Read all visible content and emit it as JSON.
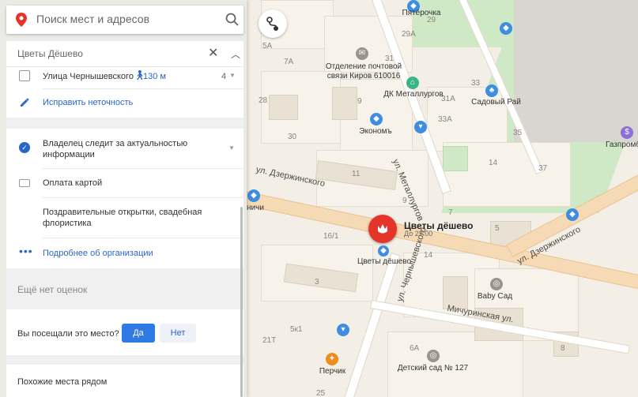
{
  "search": {
    "placeholder": "Поиск мест и адресов"
  },
  "card": {
    "title": "Цветы Дёшево",
    "address": {
      "street": "Улица Чернышевского",
      "walk": "130 м",
      "count": "4"
    },
    "fix_link": "Исправить неточность",
    "owner_notice": "Владелец следит за актуальностью информации",
    "payment": "Оплата картой",
    "services": "Поздравительные открытки, свадебная флористика",
    "more_link": "Подробнее об организации",
    "no_ratings": "Ещё нет оценок",
    "visited_question": "Вы посещали это место?",
    "yes": "Да",
    "no": "Нет",
    "similar_heading": "Похожие места рядом"
  },
  "map": {
    "main_place": {
      "name": "Цветы дёшево",
      "hours": "До 22:00",
      "label_below": "Цветы дёшево"
    },
    "streets": [
      "ул. Дзержинского",
      "ул. Дзержинского",
      "ул. Металлургов",
      "ул. Чернышевского",
      "Мичуринская ул."
    ],
    "pois": [
      {
        "name": "Пятёрочка"
      },
      {
        "name": "Отделение почтовой связи Киров 610016"
      },
      {
        "name": "ДК Металлургов"
      },
      {
        "name": "Садовый Рай"
      },
      {
        "name": "Экономъ"
      },
      {
        "name": "Газпромб"
      },
      {
        "name": "Baby Сад"
      },
      {
        "name": "Перчик"
      },
      {
        "name": "Детский сад № 127"
      },
      {
        "name": "ничи"
      }
    ],
    "house_numbers": [
      "29",
      "29А",
      "5",
      "5А",
      "7А",
      "31",
      "28",
      "9",
      "31А",
      "33",
      "33А",
      "35",
      "30",
      "11",
      "14",
      "37",
      "9",
      "7",
      "5",
      "16/1",
      "14",
      "3",
      "5к1",
      "21Т",
      "6А",
      "8",
      "25"
    ],
    "colors": {
      "accent": "#e5352a",
      "link": "#2866c8",
      "yes_button": "#2f7ae5"
    }
  }
}
